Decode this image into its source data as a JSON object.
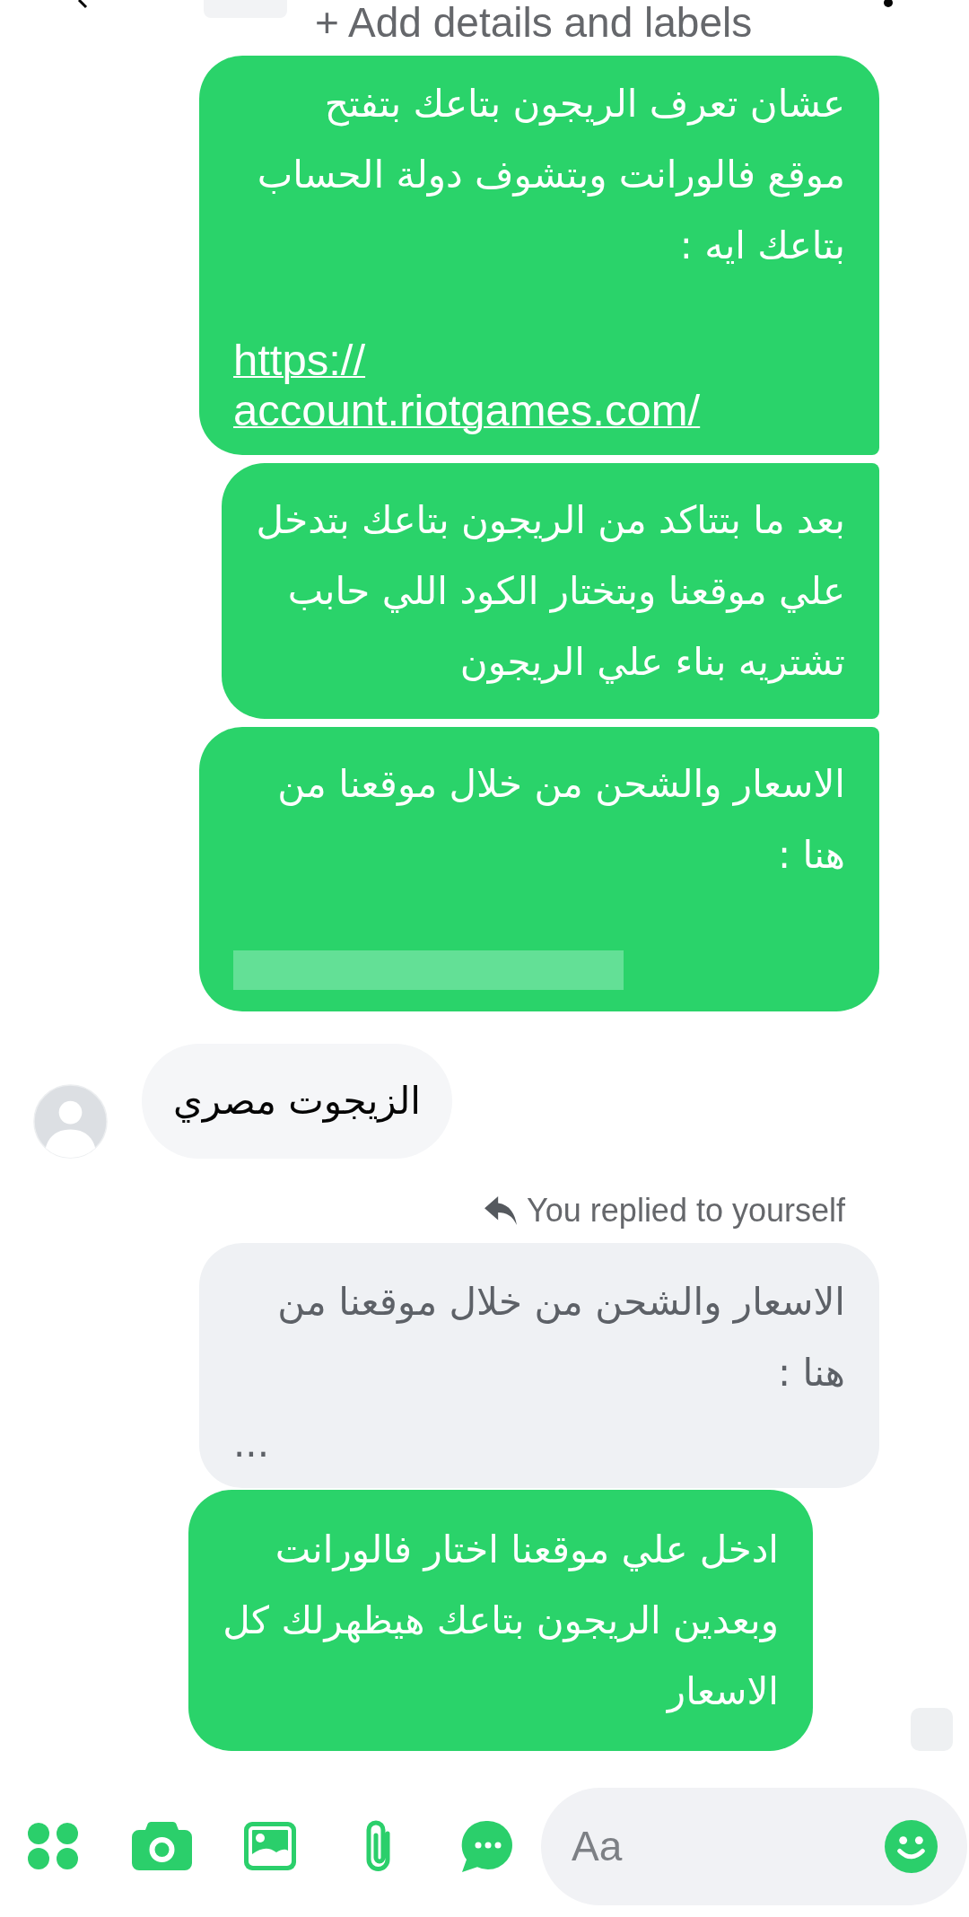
{
  "header": {
    "subtitle": "+ Add details and labels"
  },
  "messages": [
    {
      "kind": "outgoing",
      "text": "عشان تعرف الريجون بتاعك بتفتح\nموقع فالورانت وبتشوف دولة الحساب\nبتاعك ايه :",
      "link": "https://\naccount.riotgames.com/"
    },
    {
      "kind": "outgoing",
      "text": "بعد ما بتتاكد من الريجون بتاعك بتدخل\nعلي موقعنا وبتختار الكود اللي حابب\nتشتريه بناء علي الريجون"
    },
    {
      "kind": "outgoing",
      "text": "الاسعار والشحن من خلال موقعنا من\nهنا :",
      "link_redacted": true
    },
    {
      "kind": "incoming",
      "text": "الزيجوت مصري"
    },
    {
      "kind": "reply",
      "label": "You replied to yourself",
      "quoted_text": "الاسعار والشحن من خلال موقعنا من\nهنا :\n...",
      "text": "ادخل علي موقعنا اختار فالورانت\nوبعدين الريجون بتاعك هيظهرلك كل\nالاسعار"
    }
  ],
  "composer": {
    "placeholder": "Aa"
  }
}
